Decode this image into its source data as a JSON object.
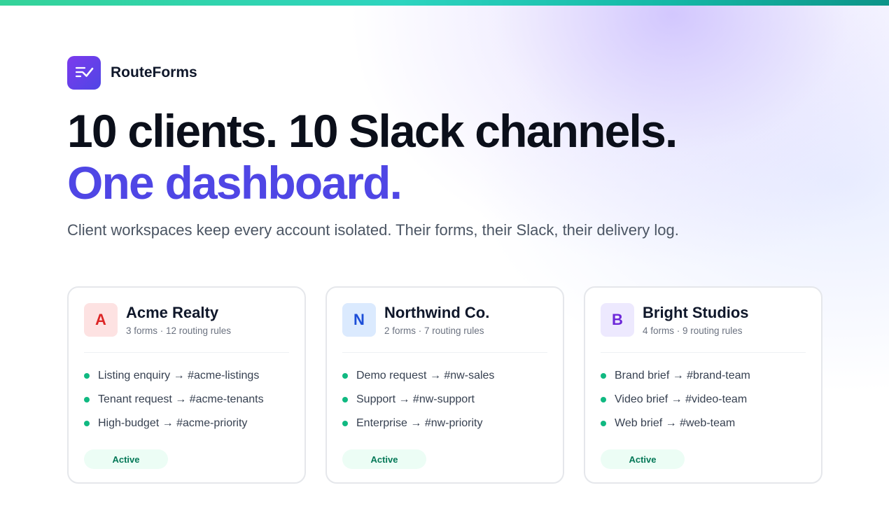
{
  "brand": {
    "name": "RouteForms",
    "logo_icon": "checklist-icon",
    "accent": "#4f46e5"
  },
  "headline": {
    "line1": "10 clients. 10 Slack channels.",
    "line2": "One dashboard."
  },
  "subheadline": "Client workspaces keep every account isolated. Their forms, their Slack, their delivery log.",
  "cards": [
    {
      "initial": "A",
      "name": "Acme Realty",
      "meta": "3 forms · 12 routing rules",
      "avatar_bg": "#fde2e2",
      "avatar_color": "#dc2626",
      "rules": [
        "Listing enquiry → #acme-listings",
        "Tenant request → #acme-tenants",
        "High-budget → #acme-priority"
      ],
      "status": "Active"
    },
    {
      "initial": "N",
      "name": "Northwind Co.",
      "meta": "2 forms · 7 routing rules",
      "avatar_bg": "#dbeafe",
      "avatar_color": "#1d4ed8",
      "rules": [
        "Demo request → #nw-sales",
        "Support → #nw-support",
        "Enterprise → #nw-priority"
      ],
      "status": "Active"
    },
    {
      "initial": "B",
      "name": "Bright Studios",
      "meta": "4 forms · 9 routing rules",
      "avatar_bg": "#ede9fe",
      "avatar_color": "#6d28d9",
      "rules": [
        "Brand brief → #brand-team",
        "Video brief → #video-team",
        "Web brief → #web-team"
      ],
      "status": "Active"
    }
  ],
  "colors": {
    "status_dot": "#10b981",
    "badge_bg": "#ecfdf5",
    "badge_text": "#047857",
    "top_bar_start": "#34d399",
    "top_bar_end": "#0d9488"
  }
}
